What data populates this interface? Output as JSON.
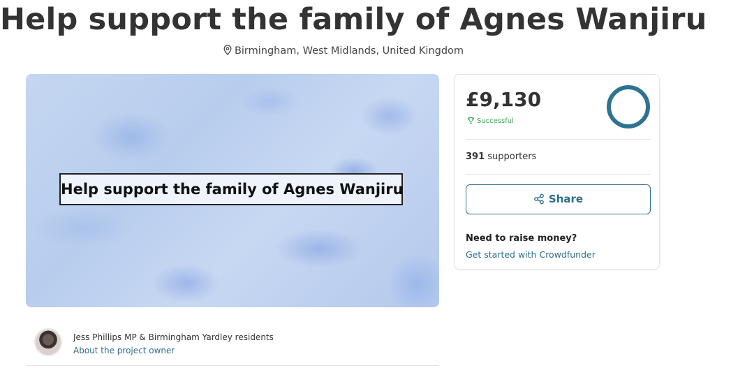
{
  "page": {
    "title": "Help support the family of Agnes Wanjiru",
    "location": "Birmingham, West Midlands, United Kingdom",
    "location_icon": "map-pin-icon"
  },
  "hero": {
    "caption": "Help support the family of Agnes Wanjiru"
  },
  "funding": {
    "amount": "£9,130",
    "status": "Successful",
    "status_color": "#3aa655",
    "progress_fraction": 1.0,
    "ring_color": "#2e7491",
    "supporters_count": "391",
    "supporters_label": "supporters",
    "share_label": "Share",
    "raise_question": "Need to raise money?",
    "raise_link": "Get started with Crowdfunder",
    "accent_color": "#2d6e8a"
  },
  "owner": {
    "name": "Jess Phillips MP & Birmingham Yardley residents",
    "link": "About the project owner"
  }
}
